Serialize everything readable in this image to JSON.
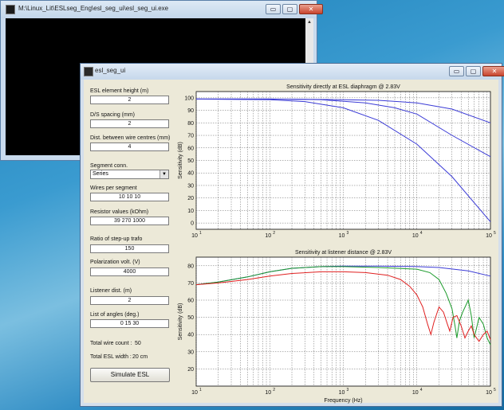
{
  "console": {
    "title": "M:\\Linux_Lit\\ESLseg_Eng\\esl_seg_ui\\esl_seg_ui.exe",
    "minimize_label": "▭",
    "maximize_label": "▢",
    "close_label": "✕",
    "scroll_up": "▲",
    "scroll_down": "▼"
  },
  "main": {
    "title": "esl_seg_ui",
    "minimize_label": "▭",
    "maximize_label": "▢",
    "close_label": "✕"
  },
  "form": {
    "element_height": {
      "label": "ESL element height (m)",
      "value": "2"
    },
    "ds_spacing": {
      "label": "D/S spacing (mm)",
      "value": "2"
    },
    "wire_dist": {
      "label": "Dist. between wire centres (mm)",
      "value": "4"
    },
    "segment_conn": {
      "label": "Segment conn.",
      "value": "Series"
    },
    "wires_per_segment": {
      "label": "Wires per segment",
      "value": "10 10 10"
    },
    "resistor_values": {
      "label": "Resistor values (kOhm)",
      "value": "39 270 1000"
    },
    "stepup_ratio": {
      "label": "Ratio of step-up trafo",
      "value": "150"
    },
    "polarization": {
      "label": "Polarization volt. (V)",
      "value": "4000"
    },
    "listener_dist": {
      "label": "Listener dist. (m)",
      "value": "2"
    },
    "angles": {
      "label": "List of angles (deg.)",
      "value": "0 15 30"
    },
    "total_wire_label": "Total wire count :",
    "total_wire_value": "50",
    "total_width_label": "Total ESL width :",
    "total_width_value": "20 cm",
    "simulate_label": "Simulate ESL"
  },
  "chart_data": [
    {
      "type": "line",
      "title": "Sensitivity directly at ESL diaphragm @ 2.83V",
      "xlabel": "",
      "ylabel": "Sensitivity (dB)",
      "xscale": "log",
      "xlim": [
        10,
        100000
      ],
      "ylim": [
        -5,
        105
      ],
      "yticks": [
        "0",
        "10",
        "20",
        "30",
        "40",
        "50",
        "60",
        "70",
        "80",
        "90",
        "100"
      ],
      "xticks": [
        "10",
        "10",
        "10",
        "10",
        "10"
      ],
      "xtick_exponents": [
        "1",
        "2",
        "3",
        "4",
        "5"
      ],
      "grid": true,
      "series": [
        {
          "color": "#3b3bd6",
          "points": [
            [
              10,
              99
            ],
            [
              100,
              99
            ],
            [
              1000,
              98.5
            ],
            [
              3000,
              98
            ],
            [
              10000,
              96
            ],
            [
              30000,
              91
            ],
            [
              100000,
              80
            ]
          ]
        },
        {
          "color": "#3b3bd6",
          "points": [
            [
              10,
              99
            ],
            [
              100,
              99
            ],
            [
              500,
              98.5
            ],
            [
              2000,
              96
            ],
            [
              5000,
              92
            ],
            [
              10000,
              87
            ],
            [
              30000,
              70
            ],
            [
              100000,
              53
            ]
          ]
        },
        {
          "color": "#3b3bd6",
          "points": [
            [
              10,
              99
            ],
            [
              100,
              98.5
            ],
            [
              300,
              97
            ],
            [
              1000,
              92
            ],
            [
              3000,
              82
            ],
            [
              10000,
              63
            ],
            [
              30000,
              37
            ],
            [
              100000,
              1
            ]
          ]
        }
      ]
    },
    {
      "type": "line",
      "title": "Sensitivity at listener distance @ 2.83V",
      "xlabel": "Frequency (Hz)",
      "ylabel": "Sensitivity (dB)",
      "xscale": "log",
      "xlim": [
        10,
        100000
      ],
      "ylim": [
        10,
        85
      ],
      "yticks": [
        "20",
        "30",
        "40",
        "50",
        "60",
        "70",
        "80"
      ],
      "xticks": [
        "10",
        "10",
        "10",
        "10",
        "10"
      ],
      "xtick_exponents": [
        "1",
        "2",
        "3",
        "4",
        "5"
      ],
      "grid": true,
      "series": [
        {
          "color": "#3b3bd6",
          "points": [
            [
              10,
              69
            ],
            [
              20,
              70.5
            ],
            [
              50,
              73.5
            ],
            [
              100,
              76.5
            ],
            [
              200,
              78.5
            ],
            [
              500,
              79.5
            ],
            [
              1000,
              79.8
            ],
            [
              3000,
              79.8
            ],
            [
              10000,
              79.5
            ],
            [
              20000,
              79
            ],
            [
              50000,
              77
            ],
            [
              100000,
              74
            ]
          ]
        },
        {
          "color": "#1a9a2a",
          "points": [
            [
              10,
              69
            ],
            [
              20,
              70.5
            ],
            [
              50,
              73.5
            ],
            [
              100,
              76.5
            ],
            [
              200,
              78.5
            ],
            [
              500,
              79.5
            ],
            [
              1000,
              79.5
            ],
            [
              3000,
              79
            ],
            [
              10000,
              78
            ],
            [
              15000,
              76
            ],
            [
              20000,
              72
            ],
            [
              25000,
              64
            ],
            [
              30000,
              55
            ],
            [
              33000,
              45
            ],
            [
              35000,
              38
            ],
            [
              38000,
              48
            ],
            [
              42000,
              53
            ],
            [
              50000,
              60
            ],
            [
              55000,
              51
            ],
            [
              60000,
              38
            ],
            [
              65000,
              44
            ],
            [
              70000,
              50
            ],
            [
              80000,
              46
            ],
            [
              90000,
              38
            ],
            [
              100000,
              34
            ]
          ]
        },
        {
          "color": "#e02020",
          "points": [
            [
              10,
              69
            ],
            [
              20,
              70
            ],
            [
              50,
              72
            ],
            [
              100,
              74
            ],
            [
              200,
              75.5
            ],
            [
              500,
              76.5
            ],
            [
              1000,
              76.5
            ],
            [
              2000,
              76
            ],
            [
              4000,
              74.5
            ],
            [
              6000,
              72
            ],
            [
              8000,
              68
            ],
            [
              10000,
              63
            ],
            [
              12000,
              56
            ],
            [
              14000,
              46
            ],
            [
              15500,
              40
            ],
            [
              17000,
              47
            ],
            [
              20000,
              56
            ],
            [
              23000,
              53
            ],
            [
              26000,
              46
            ],
            [
              28000,
              42
            ],
            [
              31000,
              50
            ],
            [
              35000,
              51
            ],
            [
              40000,
              45
            ],
            [
              45000,
              38
            ],
            [
              50000,
              42
            ],
            [
              55000,
              45
            ],
            [
              60000,
              40
            ],
            [
              70000,
              36
            ],
            [
              80000,
              40
            ],
            [
              90000,
              42
            ],
            [
              100000,
              37
            ]
          ]
        }
      ]
    }
  ]
}
